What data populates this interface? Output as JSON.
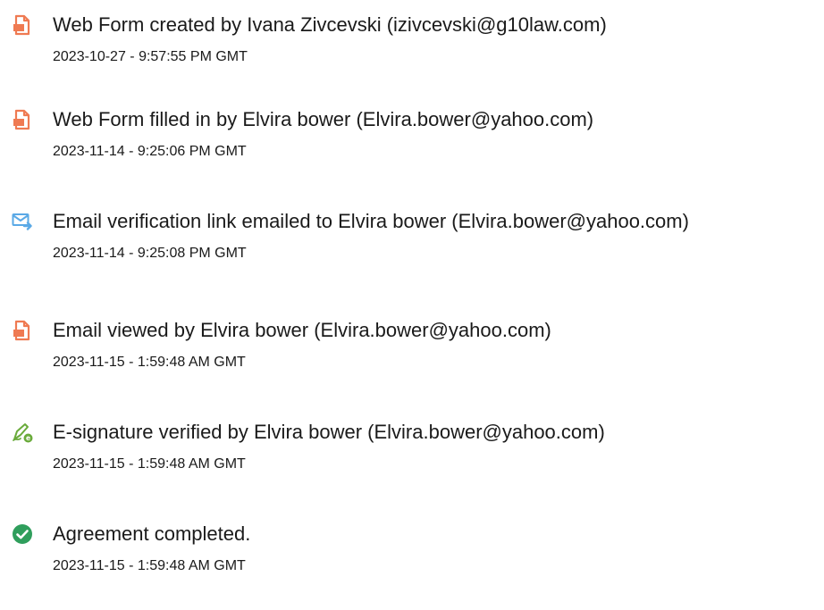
{
  "colors": {
    "text": "#1a1a1a",
    "pdf_icon": "#ef7a52",
    "email_icon": "#5aa9e6",
    "signature_icon": "#6aab3b",
    "complete_icon": "#2f9e5c"
  },
  "events": [
    {
      "icon": "document-icon",
      "title": "Web Form created by Ivana Zivcevski (izivcevski@g10law.com)",
      "timestamp": "2023-10-27 - 9:57:55 PM GMT"
    },
    {
      "icon": "document-icon",
      "title": "Web Form filled in by Elvira bower (Elvira.bower@yahoo.com)",
      "timestamp": "2023-11-14 - 9:25:06 PM GMT"
    },
    {
      "icon": "email-send-icon",
      "title": "Email verification link emailed to Elvira bower (Elvira.bower@yahoo.com)",
      "timestamp": "2023-11-14 - 9:25:08 PM GMT"
    },
    {
      "icon": "document-icon",
      "title": "Email viewed by Elvira bower (Elvira.bower@yahoo.com)",
      "timestamp": "2023-11-15 - 1:59:48 AM GMT"
    },
    {
      "icon": "e-signature-icon",
      "title": "E-signature verified by Elvira bower (Elvira.bower@yahoo.com)",
      "timestamp": "2023-11-15 - 1:59:48 AM GMT"
    },
    {
      "icon": "checkmark-circle-icon",
      "title": "Agreement completed.",
      "timestamp": "2023-11-15 - 1:59:48 AM GMT"
    }
  ]
}
